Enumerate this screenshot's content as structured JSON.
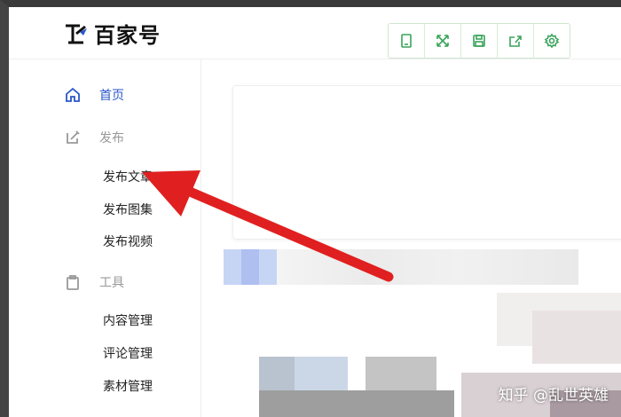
{
  "app": {
    "logo_text": "百家号"
  },
  "toolbar": {
    "icons": [
      "tablet-icon",
      "expand-icon",
      "save-icon",
      "share-icon",
      "settings-icon"
    ]
  },
  "sidebar": {
    "home_label": "首页",
    "publish_label": "发布",
    "publish_items": [
      "发布文章",
      "发布图集",
      "发布视频"
    ],
    "tools_label": "工具",
    "tools_items": [
      "内容管理",
      "评论管理",
      "素材管理"
    ]
  },
  "watermark": "知乎 @乱世英雄",
  "colors": {
    "accent_blue": "#2a57c9",
    "toolbar_green": "#3aa35a",
    "arrow_red": "#e02020"
  }
}
